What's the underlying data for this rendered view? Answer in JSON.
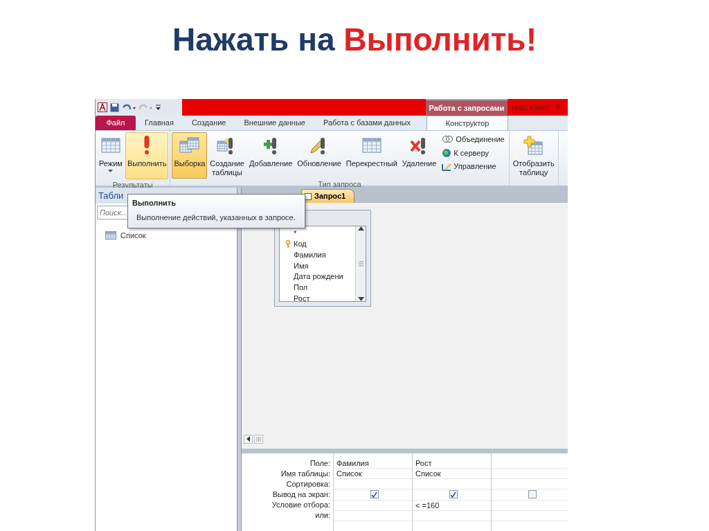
{
  "slide_title": [
    {
      "text": "Нажать на ",
      "kind": "plain"
    },
    {
      "text": "Выполнить!",
      "kind": "accent"
    }
  ],
  "window": {
    "contextual_group": "Работа с запросами",
    "title": "Наш класс : б"
  },
  "tabs": [
    {
      "label": "Файл",
      "kind": "file",
      "selected": false
    },
    {
      "label": "Главная",
      "kind": "tab",
      "selected": false
    },
    {
      "label": "Создание",
      "kind": "tab",
      "selected": false
    },
    {
      "label": "Внешние данные",
      "kind": "tab",
      "selected": false
    },
    {
      "label": "Работа с базами данных",
      "kind": "tab",
      "selected": false
    },
    {
      "label": "Конструктор",
      "kind": "contextual",
      "selected": true
    }
  ],
  "ribbon": {
    "groups": [
      {
        "label": "Результаты",
        "buttons": [
          {
            "label": "Режим",
            "kind": "grid",
            "dropdown": true,
            "hovered": false,
            "selected": false
          },
          {
            "label": "Выполнить",
            "kind": "exclaim",
            "dropdown": false,
            "hovered": true,
            "selected": false
          }
        ]
      },
      {
        "label": "Тип запроса",
        "buttons": [
          {
            "label": "Выборка",
            "kind": "tables",
            "dropdown": false,
            "hovered": false,
            "selected": true
          },
          {
            "label": "Создание\nтаблицы",
            "kind": "table-exclaim",
            "dropdown": false,
            "hovered": false,
            "selected": false
          },
          {
            "label": "Добавление",
            "kind": "plus-exclaim",
            "dropdown": false,
            "hovered": false,
            "selected": false
          },
          {
            "label": "Обновление",
            "kind": "pencil-exclaim",
            "dropdown": false,
            "hovered": false,
            "selected": false
          },
          {
            "label": "Перекрестный",
            "kind": "grid",
            "dropdown": false,
            "hovered": false,
            "selected": false
          },
          {
            "label": "Удаление",
            "kind": "x-exclaim",
            "dropdown": false,
            "hovered": false,
            "selected": false
          }
        ],
        "small_buttons": [
          {
            "label": "Объединение",
            "kind": "rings"
          },
          {
            "label": "К серверу",
            "kind": "globe"
          },
          {
            "label": "Управление",
            "kind": "ruler"
          }
        ]
      },
      {
        "buttons": [
          {
            "label": "Отобразить\nтаблицу",
            "kind": "table-plus",
            "dropdown": false,
            "hovered": false,
            "selected": false
          }
        ]
      }
    ]
  },
  "tooltip": {
    "title": "Выполнить",
    "text": "Выполнение действий, указанных в запросе."
  },
  "navigation": {
    "header": "Табли",
    "search": {
      "placeholder": "Поиск..."
    },
    "items": [
      {
        "label": "Список"
      }
    ]
  },
  "document_tabs": [
    {
      "label": "Запрос1",
      "selected": true
    }
  ],
  "table_box": {
    "fields": [
      {
        "label": "*",
        "key": false
      },
      {
        "label": "Код",
        "key": true
      },
      {
        "label": "Фамилия",
        "key": false
      },
      {
        "label": "Имя",
        "key": false
      },
      {
        "label": "Дата рождени",
        "key": false
      },
      {
        "label": "Пол",
        "key": false
      },
      {
        "label": "Рост",
        "key": false
      }
    ]
  },
  "grid": {
    "row_labels": [
      "Поле:",
      "Имя таблицы:",
      "Сортировка:",
      "Вывод на экран:",
      "Условие отбора:",
      "или:"
    ],
    "columns": [
      {
        "field": "Фамилия",
        "table": "Список",
        "show": true
      },
      {
        "field": "Рост",
        "table": "Список",
        "show": true,
        "criteria": "< =160"
      },
      {
        "show": false
      }
    ]
  }
}
